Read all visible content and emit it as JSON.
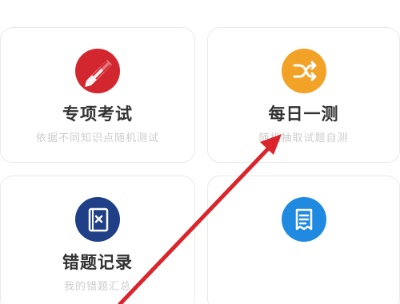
{
  "cards": [
    {
      "title": "专项考试",
      "subtitle": "依据不同知识点随机测试",
      "icon": "pencil-icon",
      "color": "#d2272e"
    },
    {
      "title": "每日一测",
      "subtitle": "随机抽取试题自测",
      "icon": "shuffle-icon",
      "color": "#f3a228"
    },
    {
      "title": "错题记录",
      "subtitle": "我的错题汇总",
      "icon": "wrong-book-icon",
      "color": "#1f3f86"
    },
    {
      "title": "",
      "subtitle": "",
      "icon": "notes-icon",
      "color": "#1f8ae0"
    }
  ],
  "annotation": {
    "arrow_color": "#d9252b",
    "arrow_icon": "red-arrow-icon"
  }
}
